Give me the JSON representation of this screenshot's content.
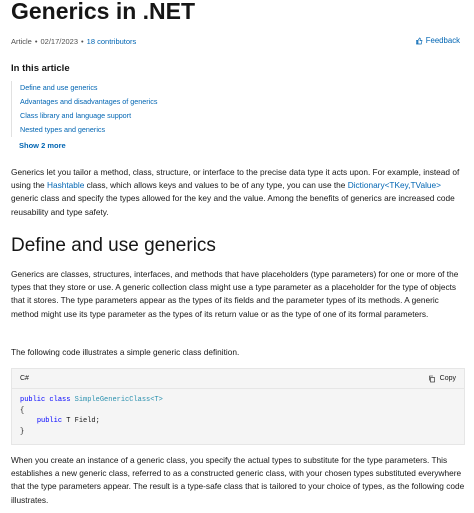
{
  "article": {
    "title": "Generics in .NET",
    "type_label": "Article",
    "separator": "•",
    "date": "02/17/2023",
    "contributors": "18 contributors",
    "feedback_label": "Feedback"
  },
  "toc": {
    "heading": "In this article",
    "items": [
      "Define and use generics",
      "Advantages and disadvantages of generics",
      "Class library and language support",
      "Nested types and generics"
    ],
    "show_more": "Show 2 more"
  },
  "intro": {
    "part1": "Generics let you tailor a method, class, structure, or interface to the precise data type it acts upon. For example, instead of using the ",
    "link1": "Hashtable",
    "part2": " class, which allows keys and values to be of any type, you can use the ",
    "link2": "Dictionary<TKey,TValue>",
    "part3": " generic class and specify the types allowed for the key and the value. Among the benefits of generics are increased code reusability and type safety."
  },
  "section": {
    "heading": "Define and use generics",
    "para1": "Generics are classes, structures, interfaces, and methods that have placeholders (type parameters) for one or more of the types that they store or use. A generic collection class might use a type parameter as a placeholder for the type of objects that it stores. The type parameters appear as the types of its fields and the parameter types of its methods. A generic method might use its type parameter as the types of its return value or as the type of one of its formal parameters.",
    "para2": "The following code illustrates a simple generic class definition.",
    "para3": "When you create an instance of a generic class, you specify the actual types to substitute for the type parameters. This establishes a new generic class, referred to as a constructed generic class, with your chosen types substituted everywhere that the type parameters appear. The result is a type-safe class that is tailored to your choice of types, as the following code illustrates."
  },
  "code": {
    "language": "C#",
    "copy_label": "Copy",
    "kw_public": "public",
    "kw_class": "class",
    "class_name": "SimpleGenericClass<T>",
    "open_brace": "{",
    "field_kw": "public",
    "field_rest": " T Field;",
    "close_brace": "}"
  },
  "icons": {
    "feedback": "thumbs-feedback-icon",
    "copy": "copy-icon"
  },
  "colors": {
    "link": "#0065b3",
    "keyword": "#0000ff",
    "type": "#2b91af"
  }
}
